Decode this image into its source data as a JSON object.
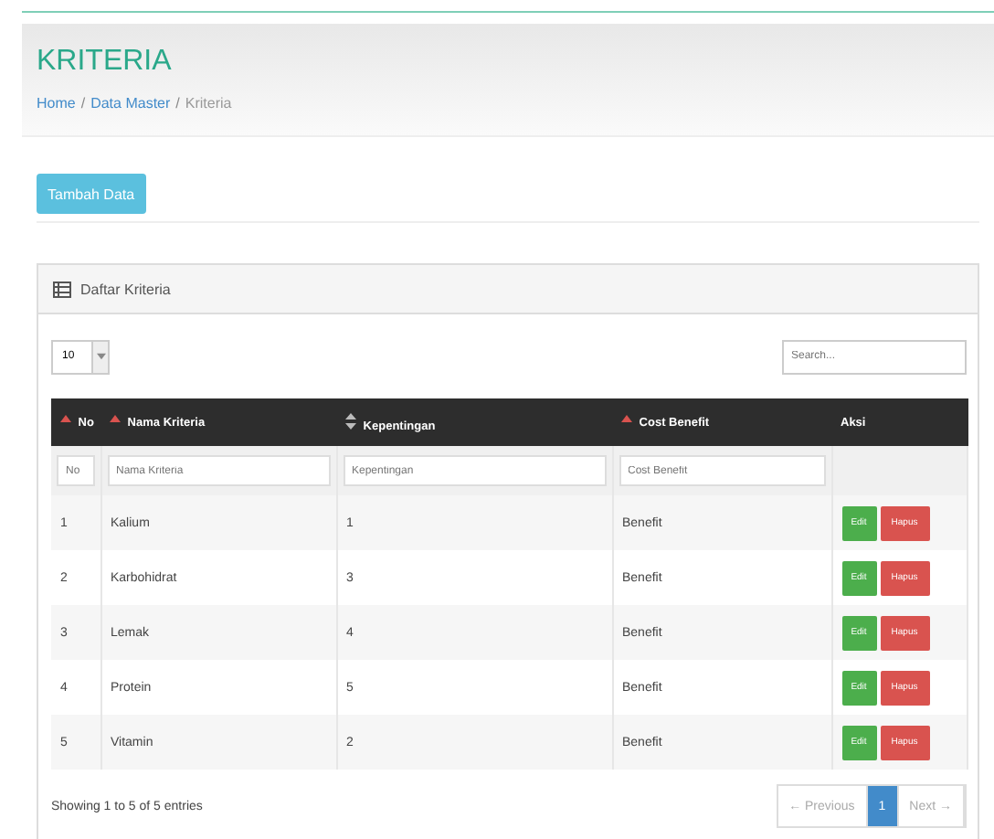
{
  "page_title": "KRITERIA",
  "breadcrumb": [
    {
      "label": "Home",
      "link": true
    },
    {
      "separator": "/",
      "label": "Data Master",
      "link": true
    },
    {
      "separator": "/",
      "label": "Kriteria",
      "link": false
    }
  ],
  "add_button": "Tambah Data",
  "panel": {
    "title": "Daftar Kriteria",
    "page_size": "10",
    "search": {
      "placeholder": "Search..."
    },
    "columns": [
      {
        "label": "No",
        "kind": "sorted"
      },
      {
        "label": "Nama Kriteria",
        "kind": "sorted"
      },
      {
        "label": "Kepentingan",
        "kind": "unsorted"
      },
      {
        "label": "Cost Benefit",
        "kind": "sorted"
      },
      {
        "label": "Aksi",
        "kind": "plain"
      }
    ],
    "filters": [
      {
        "placeholder": "No"
      },
      {
        "placeholder": "Nama Kriteria"
      },
      {
        "placeholder": "Kepentingan"
      },
      {
        "placeholder": "Cost Benefit"
      }
    ],
    "rows": [
      {
        "cells": [
          "1",
          "Kalium",
          "1",
          "Benefit"
        ],
        "actions": [
          "Edit",
          "Hapus"
        ]
      },
      {
        "cells": [
          "2",
          "Karbohidrat",
          "3",
          "Benefit"
        ],
        "actions": [
          "Edit",
          "Hapus"
        ]
      },
      {
        "cells": [
          "3",
          "Lemak",
          "4",
          "Benefit"
        ],
        "actions": [
          "Edit",
          "Hapus"
        ]
      },
      {
        "cells": [
          "4",
          "Protein",
          "5",
          "Benefit"
        ],
        "actions": [
          "Edit",
          "Hapus"
        ]
      },
      {
        "cells": [
          "5",
          "Vitamin",
          "2",
          "Benefit"
        ],
        "actions": [
          "Edit",
          "Hapus"
        ]
      }
    ],
    "info": "Showing 1 to 5 of 5 entries",
    "pagination": [
      {
        "label": "← Previous",
        "selected": false,
        "disabled": true
      },
      {
        "label": "1",
        "selected": true,
        "disabled": false
      },
      {
        "label": "Next →",
        "selected": false,
        "disabled": true
      }
    ]
  }
}
